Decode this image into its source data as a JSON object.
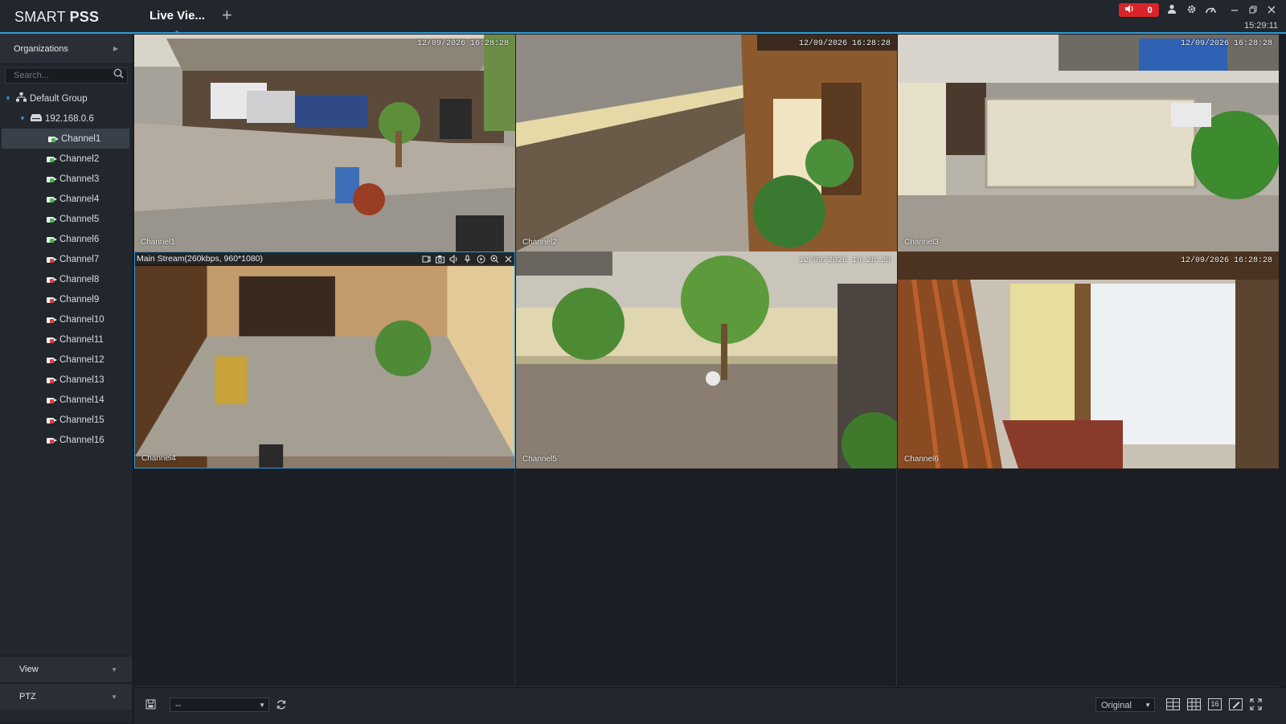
{
  "app": {
    "logo_light": "SMART ",
    "logo_bold": "PSS",
    "active_tab": "Live Vie...",
    "add_tab_icon": "plus-icon",
    "alarm_count": "0",
    "clock": "15:29:11",
    "accent_color": "#2f9cd6",
    "alarm_color": "#d9242a"
  },
  "sidebar": {
    "organizations_label": "Organizations",
    "search_placeholder": "Search...",
    "group_label": "Default Group",
    "device_label": "192.168.0.6",
    "channels": [
      {
        "label": "Channel1",
        "status": "online"
      },
      {
        "label": "Channel2",
        "status": "online"
      },
      {
        "label": "Channel3",
        "status": "online"
      },
      {
        "label": "Channel4",
        "status": "online"
      },
      {
        "label": "Channel5",
        "status": "online"
      },
      {
        "label": "Channel6",
        "status": "online"
      },
      {
        "label": "Channel7",
        "status": "offline"
      },
      {
        "label": "Channel8",
        "status": "offline"
      },
      {
        "label": "Channel9",
        "status": "offline"
      },
      {
        "label": "Channel10",
        "status": "offline"
      },
      {
        "label": "Channel11",
        "status": "offline"
      },
      {
        "label": "Channel12",
        "status": "offline"
      },
      {
        "label": "Channel13",
        "status": "offline"
      },
      {
        "label": "Channel14",
        "status": "offline"
      },
      {
        "label": "Channel15",
        "status": "offline"
      },
      {
        "label": "Channel16",
        "status": "offline"
      }
    ],
    "view_label": "View",
    "ptz_label": "PTZ"
  },
  "video": {
    "timestamp": "12/09/2026 16:28:28",
    "selected_stream_info": "Main Stream(260kbps, 960*1080)",
    "cells": [
      {
        "name": "Channel1",
        "scene": "carport"
      },
      {
        "name": "Channel2",
        "scene": "alley"
      },
      {
        "name": "Channel3",
        "scene": "street"
      },
      {
        "name": "Channel4",
        "scene": "porch"
      },
      {
        "name": "Channel5",
        "scene": "yard"
      },
      {
        "name": "Channel6",
        "scene": "doorway"
      }
    ]
  },
  "toolbar": {
    "view_select_value": "--",
    "ratio_value": "Original",
    "layout_16_label": "16"
  }
}
